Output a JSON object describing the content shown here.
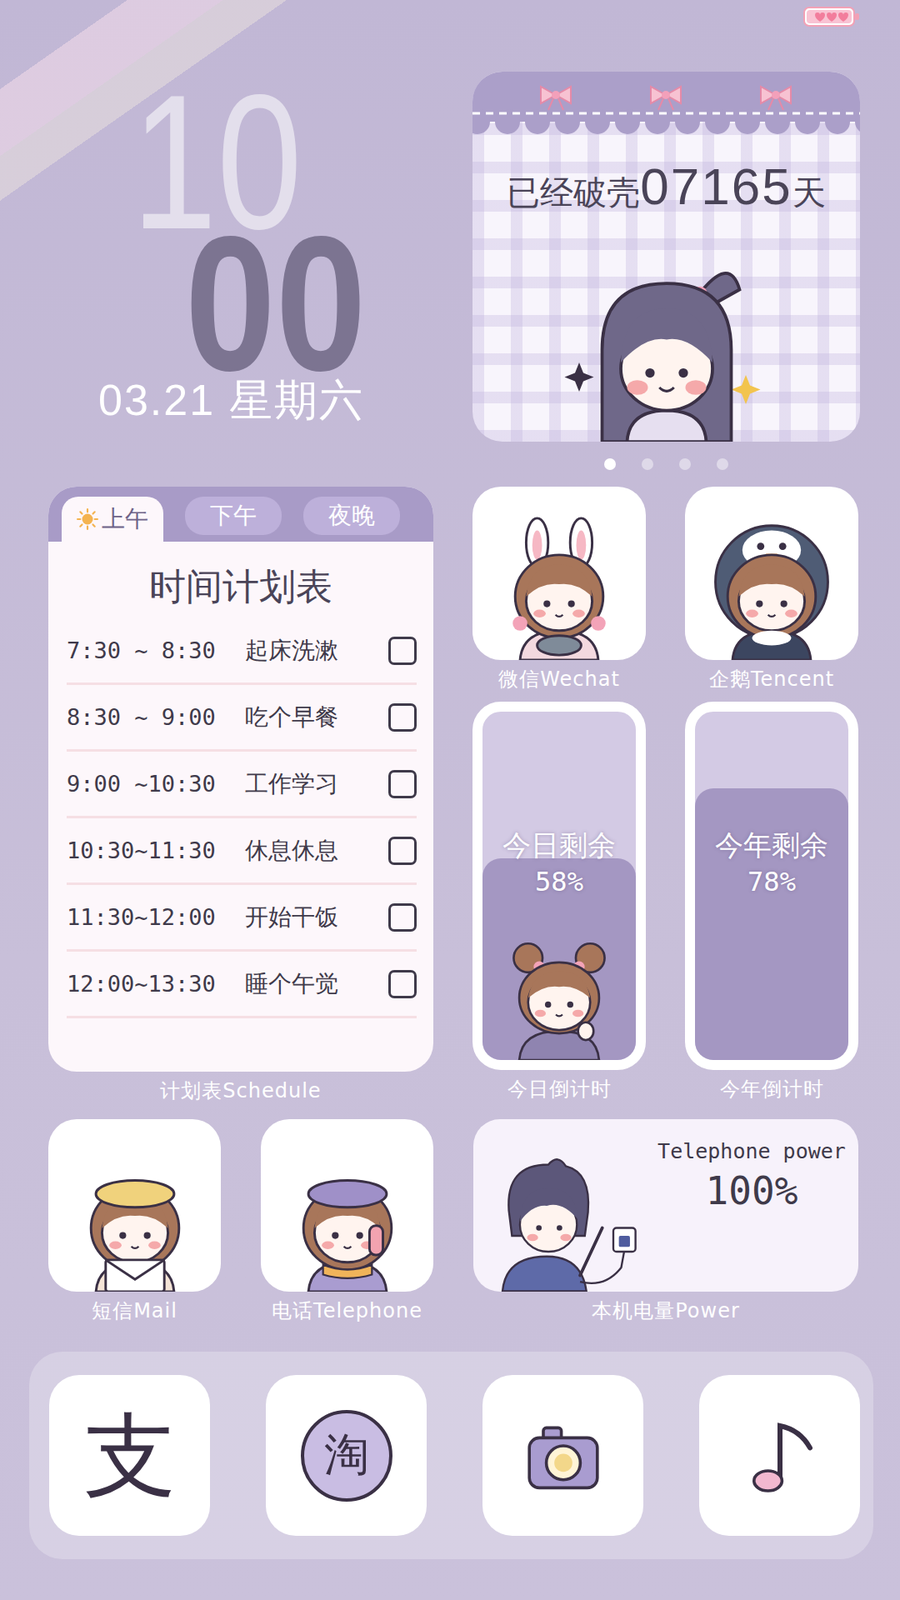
{
  "status_bar": {
    "battery_level": 1
  },
  "clock": {
    "hour": "10",
    "minute": "00",
    "date": "03.21 星期六"
  },
  "days_card": {
    "prefix": "已经破壳",
    "count": "07165",
    "suffix": "天"
  },
  "page_dots": [
    {
      "selected": true
    },
    {
      "selected": false
    },
    {
      "selected": false
    },
    {
      "selected": false
    }
  ],
  "schedule": {
    "tabs": [
      {
        "label": "上午",
        "selected": true
      },
      {
        "label": "下午",
        "selected": false
      },
      {
        "label": "夜晚",
        "selected": false
      }
    ],
    "title": "时间计划表",
    "rows": [
      {
        "time": "7:30 ~ 8:30",
        "task": "起床洗漱",
        "checked": false
      },
      {
        "time": "8:30 ~ 9:00",
        "task": "吃个早餐",
        "checked": false
      },
      {
        "time": "9:00 ~10:30",
        "task": "工作学习",
        "checked": false
      },
      {
        "time": "10:30~11:30",
        "task": "休息休息",
        "checked": false
      },
      {
        "time": "11:30~12:00",
        "task": "开始干饭",
        "checked": false
      },
      {
        "time": "12:00~13:30",
        "task": "睡个午觉",
        "checked": false
      }
    ],
    "label": "计划表Schedule"
  },
  "social_apps": [
    {
      "label": "微信Wechat",
      "kind": "bunny"
    },
    {
      "label": "企鹅Tencent",
      "kind": "penguin"
    }
  ],
  "countdowns": [
    {
      "title": "今日剩余",
      "percent": "58%",
      "level": 0.58,
      "label": "今日倒计时",
      "kind": "figure"
    },
    {
      "title": "今年剩余",
      "percent": "78%",
      "level": 0.78,
      "label": "今年倒计时",
      "kind": "plain"
    }
  ],
  "contact_apps": [
    {
      "label": "短信Mail",
      "kind": "mail"
    },
    {
      "label": "电话Telephone",
      "kind": "phone"
    }
  ],
  "power": {
    "title": "Telephone power",
    "reading": "100%",
    "label": "本机电量Power"
  },
  "dock": [
    {
      "kind": "glyph",
      "glyph": "支"
    },
    {
      "kind": "badge",
      "glyph": "淘"
    },
    {
      "kind": "camera"
    },
    {
      "kind": "music"
    }
  ]
}
